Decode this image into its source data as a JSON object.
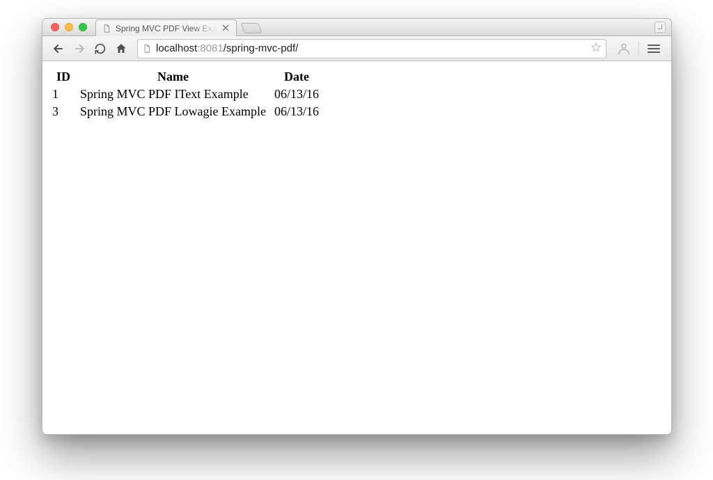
{
  "tab": {
    "title": "Spring MVC PDF View Exa"
  },
  "url": {
    "host": "localhost",
    "port": ":8081",
    "path": "/spring-mvc-pdf/"
  },
  "table": {
    "headers": {
      "id": "ID",
      "name": "Name",
      "date": "Date"
    },
    "rows": [
      {
        "id": "1",
        "name": "Spring MVC PDF IText Example",
        "date": "06/13/16"
      },
      {
        "id": "3",
        "name": "Spring MVC PDF Lowagie Example",
        "date": "06/13/16"
      }
    ]
  }
}
